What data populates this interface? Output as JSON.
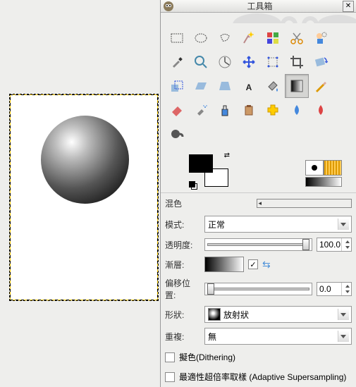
{
  "window": {
    "title": "工具箱"
  },
  "tools": [
    "rect-select",
    "ellipse-select",
    "free-select",
    "fuzzy-select",
    "color-select",
    "scissors",
    "fg-select",
    "color-picker",
    "zoom",
    "measure",
    "move",
    "align",
    "crop",
    "rotate",
    "scale",
    "shear",
    "perspective",
    "text",
    "bucket",
    "blend",
    "pencil",
    "eraser",
    "airbrush",
    "ink",
    "clone",
    "heal",
    "blur",
    "dodge",
    "smudge"
  ],
  "selected_tool": "blend",
  "brush_pattern": {
    "dot": true
  },
  "options": {
    "section_title": "混色",
    "mode": {
      "label": "模式:",
      "value": "正常"
    },
    "opacity": {
      "label": "透明度:",
      "value": "100.0"
    },
    "gradient": {
      "label": "漸層:",
      "reverse_checked": true
    },
    "offset": {
      "label": "偏移位置:",
      "value": "0.0"
    },
    "shape": {
      "label": "形狀:",
      "value": "放射狀"
    },
    "repeat": {
      "label": "重複:",
      "value": "無"
    },
    "dithering": {
      "label": "擬色(Dithering)",
      "checked": false
    },
    "supersampling": {
      "label": "最適性超倍率取樣 (Adaptive Supersampling)",
      "checked": false
    }
  }
}
